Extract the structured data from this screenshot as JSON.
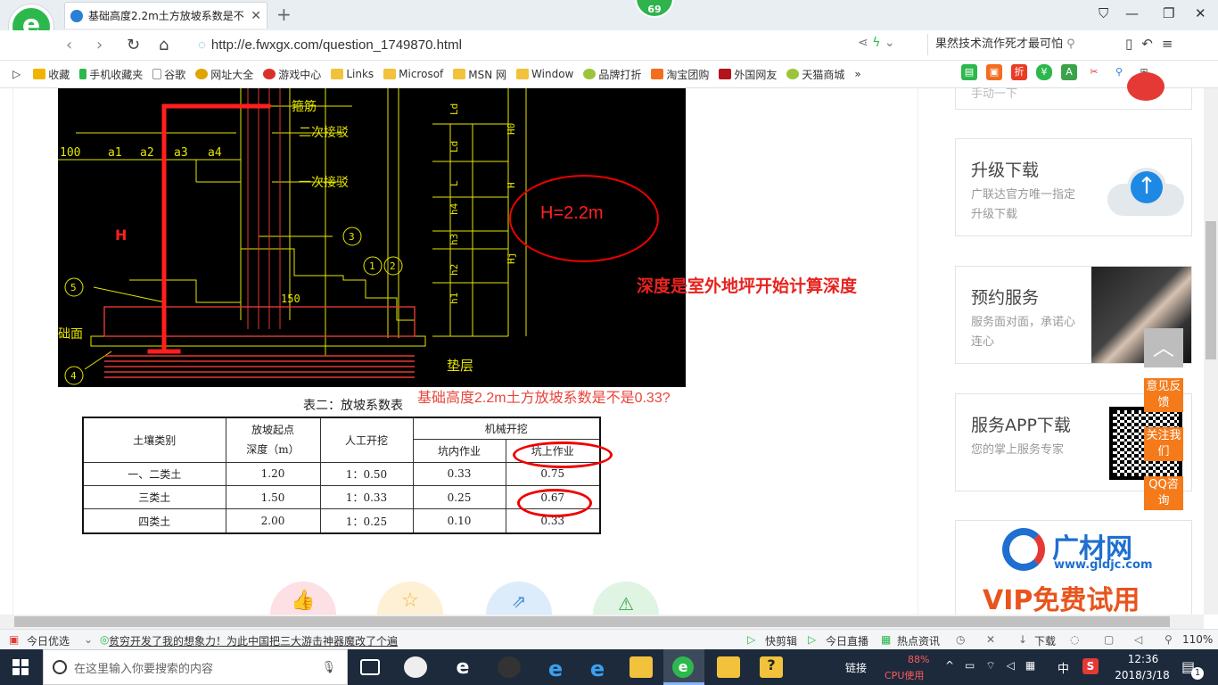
{
  "browser": {
    "tab_title": "基础高度2.2m土方放坡系数是不",
    "notification_count": "69",
    "url": "http://e.fwxgx.com/question_1749870.html",
    "search_text": "果然技术流作死才最可怕"
  },
  "bookmarks": [
    "收藏",
    "手机收藏夹",
    "谷歌",
    "网址大全",
    "游戏中心",
    "Links",
    "Microsof",
    "MSN 网",
    "Window",
    "品牌打折",
    "淘宝团购",
    "外国网友",
    "天猫商城"
  ],
  "cad": {
    "labels": {
      "stirrup": "箍筋",
      "second_joint": "二次接驳",
      "first_joint": "一次接驳",
      "h_letter": "H",
      "dim_100": "100",
      "a1": "a1",
      "a2": "a2",
      "a3": "a3",
      "a4": "a4",
      "ld1": "Ld",
      "ld2": "Ld",
      "l": "L",
      "h4": "h4",
      "h3": "h3",
      "h2": "h2",
      "h1": "h1",
      "h0": "H0",
      "hj": "Hj",
      "h_dim": "H",
      "c3": "3",
      "c1": "1",
      "c2": "2",
      "c5": "5",
      "c4": "4",
      "n150": "150",
      "base_surface": "础面",
      "cushion": "垫层",
      "h_value": "H=2.2m"
    },
    "annotation": "深度是室外地坪开始计算深度"
  },
  "table": {
    "title": "表二：放坡系数表",
    "question": "基础高度2.2m土方放坡系数是不是0.33?",
    "headers": {
      "soil": "土壤类别",
      "depth_line1": "放坡起点",
      "depth_line2": "深度（m）",
      "manual": "人工开挖",
      "mech": "机械开挖",
      "pit_in": "坑内作业",
      "pit_on": "坑上作业"
    },
    "rows": [
      {
        "soil": "一、二类土",
        "depth": "1.20",
        "manual": "1：0.50",
        "pit_in": "0.33",
        "pit_on": "0.75"
      },
      {
        "soil": "三类土",
        "depth": "1.50",
        "manual": "1：0.33",
        "pit_in": "0.25",
        "pit_on": "0.67"
      },
      {
        "soil": "四类土",
        "depth": "2.00",
        "manual": "1：0.25",
        "pit_in": "0.10",
        "pit_on": "0.33"
      }
    ]
  },
  "sidebar": {
    "top_partial": "手动一下",
    "upgrade": {
      "title": "升级下载",
      "desc": "广联达官方唯一指定升级下载"
    },
    "reserve": {
      "title": "预约服务",
      "desc": "服务面对面，承诺心连心"
    },
    "app": {
      "title": "服务APP下载",
      "desc": "您的掌上服务专家"
    },
    "ad": {
      "brand": "广材网",
      "site": "www.gldjc.com",
      "vip": "VIP免费试用"
    }
  },
  "float_buttons": [
    "意见反馈",
    "关注我们",
    "QQ咨询"
  ],
  "statusbar": {
    "today": "今日优选",
    "news": "贫穷开发了我的想象力！为此中国把三大游击神器魔改了个遍",
    "quick_clip": "快剪辑",
    "live": "今日直播",
    "hot_news": "热点资讯",
    "download": "下载",
    "zoom": "110%"
  },
  "taskbar": {
    "search_placeholder": "在这里输入你要搜索的内容",
    "link_label": "链接",
    "cpu_percent": "88%",
    "cpu_label": "CPU使用",
    "ime": "中",
    "time": "12:36",
    "date": "2018/3/18",
    "notif": "1"
  }
}
